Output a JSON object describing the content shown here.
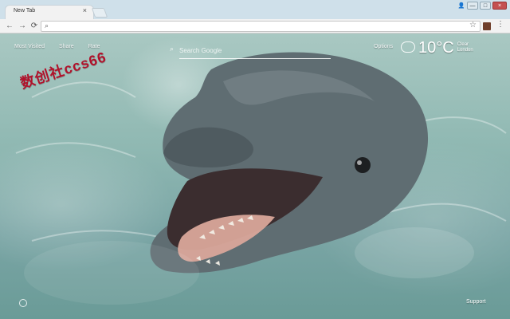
{
  "browser": {
    "tab": {
      "title": "New Tab"
    },
    "toolbar": {
      "back_icon": "back-arrow-icon",
      "forward_icon": "forward-arrow-icon",
      "reload_icon": "reload-icon"
    },
    "omnibox": {
      "placeholder": ""
    }
  },
  "newtab": {
    "nav": {
      "most_visited": "Most Visited",
      "share": "Share",
      "rate": "Rate"
    },
    "search": {
      "placeholder": "Search Google"
    },
    "options_label": "Options",
    "weather": {
      "temperature": "10°C",
      "condition": "Clear",
      "location": "London",
      "icon": "cloud-icon"
    },
    "watermark_text": "数创社ccs66",
    "support_label": "Support"
  },
  "colors": {
    "watermark": "#b1122b"
  }
}
